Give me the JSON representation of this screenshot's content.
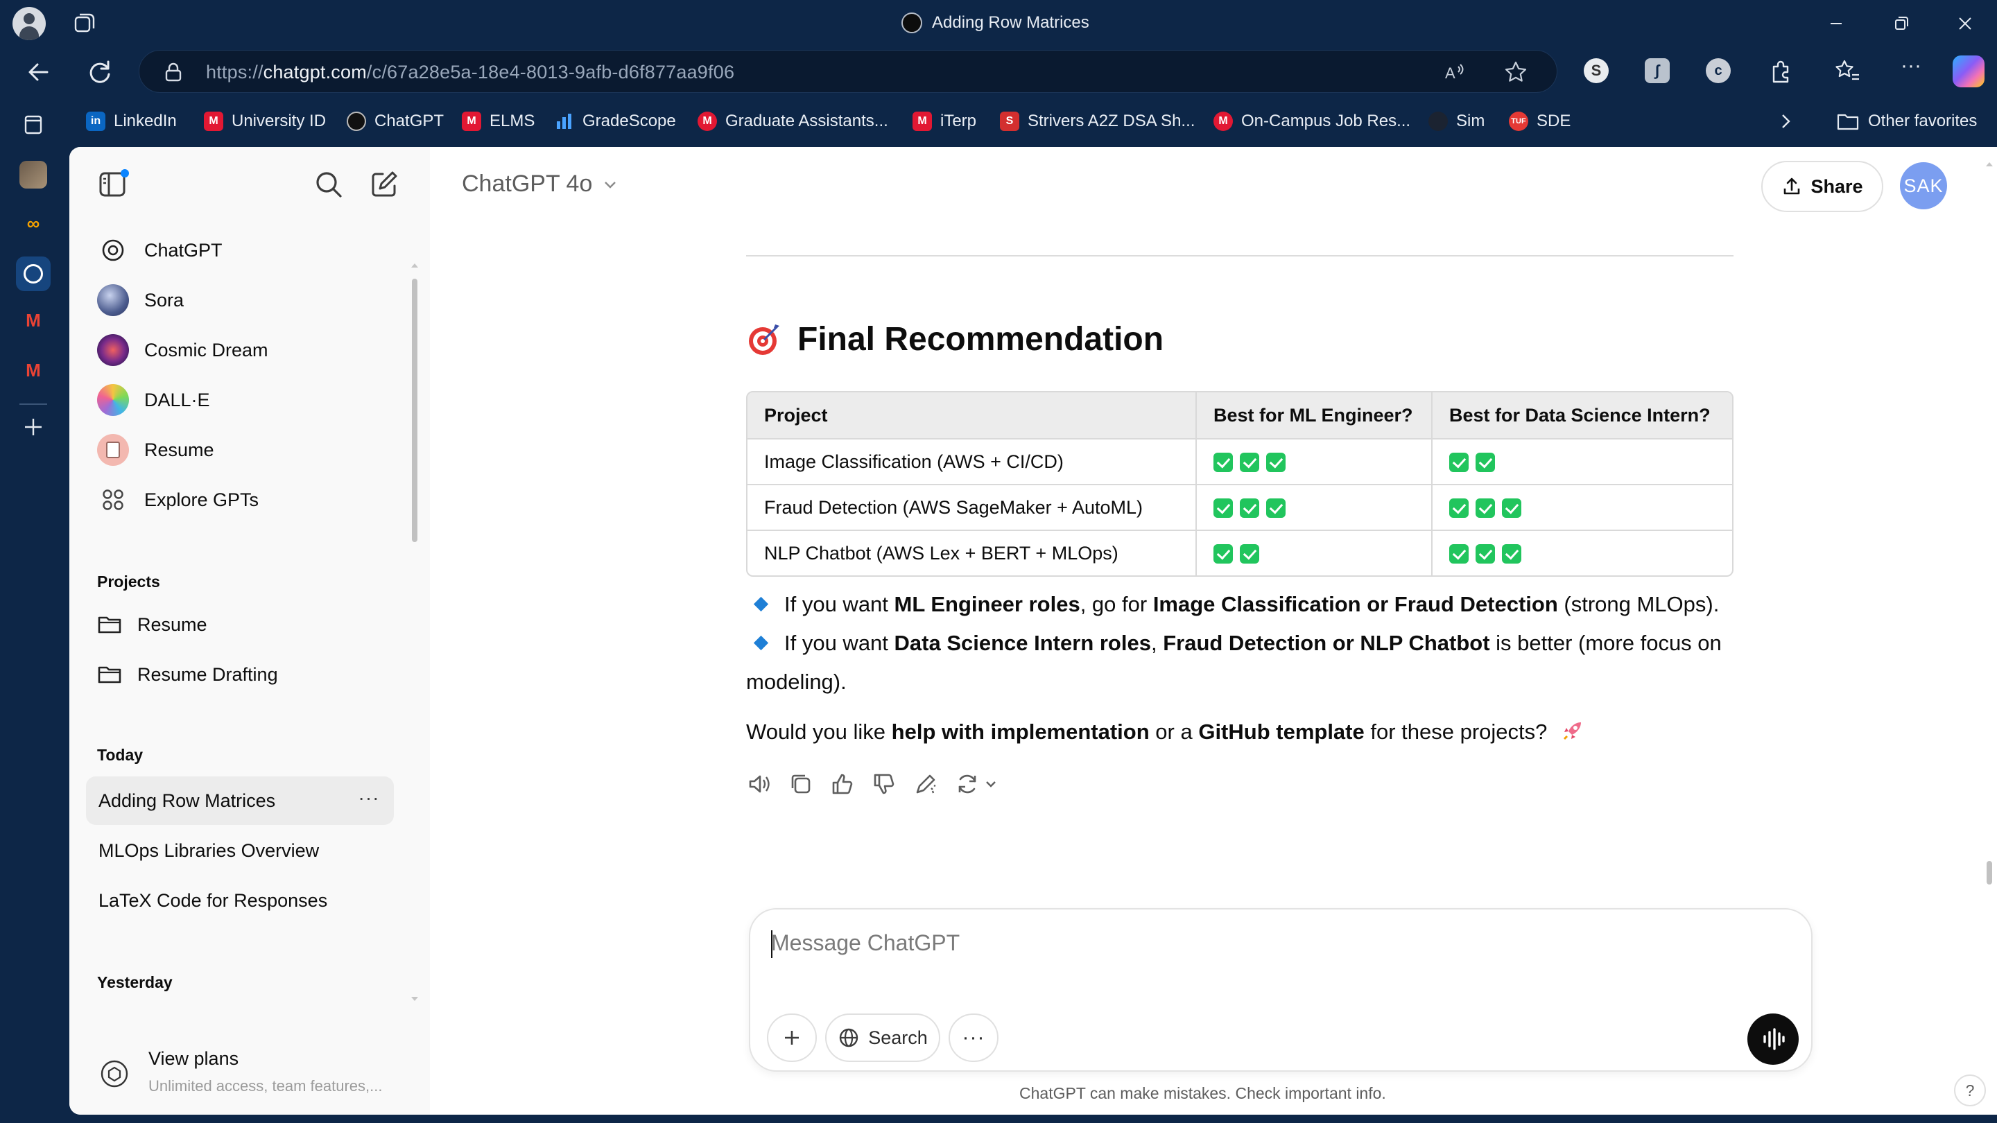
{
  "window": {
    "title": "Adding Row Matrices",
    "url_prefix": "https://",
    "url_host": "chatgpt.com",
    "url_path": "/c/67a28e5a-18e4-8013-9afb-d6f877aa9f06"
  },
  "favorites": [
    {
      "label": "LinkedIn",
      "icon": "linkedin-icon",
      "color": "#0a66c2"
    },
    {
      "label": "University ID",
      "icon": "umd-icon",
      "color": "#e21833"
    },
    {
      "label": "ChatGPT",
      "icon": "chatgpt-icon",
      "color": "#111111"
    },
    {
      "label": "ELMS",
      "icon": "umd-icon",
      "color": "#e21833"
    },
    {
      "label": "GradeScope",
      "icon": "gradescope-icon",
      "color": "#2b7de9"
    },
    {
      "label": "Graduate Assistants...",
      "icon": "umd-icon",
      "color": "#e21833"
    },
    {
      "label": "iTerp",
      "icon": "umd-icon",
      "color": "#e21833"
    },
    {
      "label": "Strivers A2Z DSA Sh...",
      "icon": "takeuforward-icon",
      "color": "#d32f2f"
    },
    {
      "label": "On-Campus Job Res...",
      "icon": "umd-icon",
      "color": "#e21833"
    },
    {
      "label": "Sim",
      "icon": "github-icon",
      "color": "#222222"
    },
    {
      "label": "SDE",
      "icon": "tuf-icon",
      "color": "#e53935"
    }
  ],
  "other_favorites": "Other favorites",
  "sidebar": {
    "gpts": [
      {
        "label": "ChatGPT",
        "icon": "chatgpt-icon"
      },
      {
        "label": "Sora",
        "icon": "sora-icon"
      },
      {
        "label": "Cosmic Dream",
        "icon": "cosmic-dream-icon"
      },
      {
        "label": "DALL·E",
        "icon": "dalle-icon"
      },
      {
        "label": "Resume",
        "icon": "resume-gpt-icon"
      },
      {
        "label": "Explore GPTs",
        "icon": "grid-icon"
      }
    ],
    "projects_heading": "Projects",
    "projects": [
      "Resume",
      "Resume Drafting"
    ],
    "today_heading": "Today",
    "today": [
      "Adding Row Matrices",
      "MLOps Libraries Overview",
      "LaTeX Code for Responses"
    ],
    "yesterday_heading": "Yesterday",
    "view_plans_title": "View plans",
    "view_plans_sub": "Unlimited access, team features,..."
  },
  "header": {
    "model": "ChatGPT 4o",
    "share_label": "Share",
    "avatar_initials": "SAK"
  },
  "message": {
    "heading": "Final Recommendation",
    "table": {
      "headers": [
        "Project",
        "Best for ML Engineer?",
        "Best for Data Science Intern?"
      ],
      "rows": [
        {
          "project": "Image Classification (AWS + CI/CD)",
          "ml_checks": 3,
          "ds_checks": 2
        },
        {
          "project": "Fraud Detection (AWS SageMaker + AutoML)",
          "ml_checks": 3,
          "ds_checks": 3
        },
        {
          "project": "NLP Chatbot (AWS Lex + BERT + MLOps)",
          "ml_checks": 2,
          "ds_checks": 3
        }
      ]
    },
    "bullet1": {
      "pre": "If you want ",
      "b1": "ML Engineer roles",
      "mid": ", go for ",
      "b2": "Image Classification or Fraud Detection",
      "post": " (strong MLOps)."
    },
    "bullet2": {
      "pre": "If you want ",
      "b1": "Data Science Intern roles",
      "mid": ", ",
      "b2": "Fraud Detection or NLP Chatbot",
      "post1": " is better (more focus on",
      "post2": "modeling)."
    },
    "closing": {
      "pre": "Would you like ",
      "b1": "help with implementation",
      "mid": " or a ",
      "b2": "GitHub template",
      "post": " for these projects?"
    }
  },
  "composer": {
    "placeholder": "Message ChatGPT",
    "search_label": "Search"
  },
  "disclaimer": "ChatGPT can make mistakes. Check important info.",
  "help": "?"
}
